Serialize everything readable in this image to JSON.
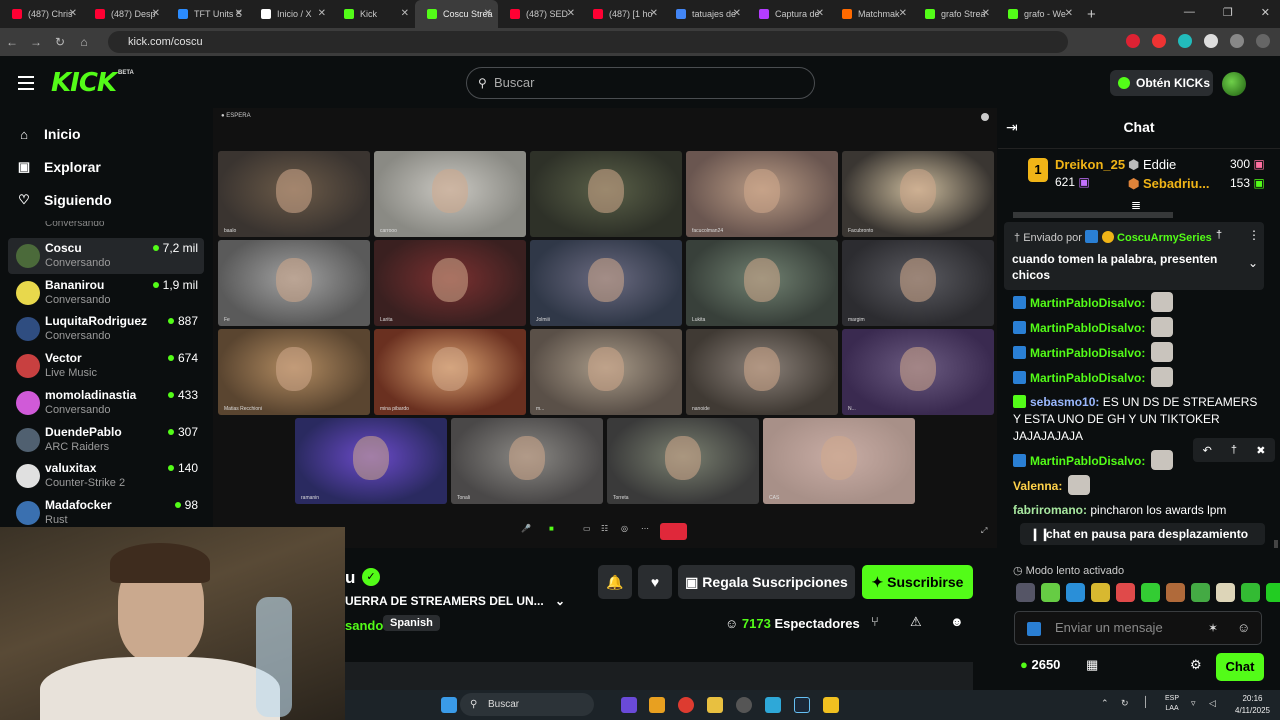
{
  "browser": {
    "tabs": [
      {
        "label": "(487) Chris",
        "color": "#ff0033"
      },
      {
        "label": "(487) Desp",
        "color": "#ff0033"
      },
      {
        "label": "TFT Units S",
        "color": "#2b8cff"
      },
      {
        "label": "Inicio / X",
        "color": "#ffffff"
      },
      {
        "label": "Kick",
        "color": "#53fc18"
      },
      {
        "label": "Coscu Strea",
        "color": "#53fc18"
      },
      {
        "label": "(487) SED",
        "color": "#ff0033"
      },
      {
        "label": "(487) [1 ho",
        "color": "#ff0033"
      },
      {
        "label": "tatuajes de",
        "color": "#4285f4"
      },
      {
        "label": "Captura de",
        "color": "#b43cff"
      },
      {
        "label": "Matchmak",
        "color": "#ff6a00"
      },
      {
        "label": "grafo Strea",
        "color": "#53fc18"
      },
      {
        "label": "grafo - We",
        "color": "#53fc18"
      }
    ],
    "url": "kick.com/coscu"
  },
  "header": {
    "logo": "KICK",
    "beta": "BETA",
    "search_placeholder": "Buscar",
    "kicks_button": "Obtén KICKs"
  },
  "sidebar": {
    "nav": [
      {
        "label": "Inicio",
        "icon": "home-icon"
      },
      {
        "label": "Explorar",
        "icon": "compass-icon"
      },
      {
        "label": "Siguiendo",
        "icon": "heart-icon"
      }
    ],
    "partial_top": "Conversando",
    "channels": [
      {
        "name": "Coscu",
        "sub": "Conversando",
        "viewers": "7,2 mil",
        "color": "#4b6a3a"
      },
      {
        "name": "Bananirou",
        "sub": "Conversando",
        "viewers": "1,9 mil",
        "color": "#e8d84c"
      },
      {
        "name": "LuquitaRodriguez",
        "sub": "Conversando",
        "viewers": "887",
        "color": "#2f4d80"
      },
      {
        "name": "Vector",
        "sub": "Live Music",
        "viewers": "674",
        "color": "#c84040"
      },
      {
        "name": "momoladinastia",
        "sub": "Conversando",
        "viewers": "433",
        "color": "#d05ad8"
      },
      {
        "name": "DuendePablo",
        "sub": "ARC Raiders",
        "viewers": "307",
        "color": "#506070"
      },
      {
        "name": "valuxitax",
        "sub": "Counter-Strike 2",
        "viewers": "140",
        "color": "#e0e0e0"
      },
      {
        "name": "Madafocker",
        "sub": "Rust",
        "viewers": "98",
        "color": "#3a70b0"
      }
    ]
  },
  "video": {
    "status": "ESPERA",
    "tiles": [
      {
        "name": "baalo",
        "c1": "#3a3430",
        "c2": "#6b5a48"
      },
      {
        "name": "carrooo",
        "c1": "#8a8a84",
        "c2": "#c8c6c0"
      },
      {
        "name": "",
        "c1": "#2e3128",
        "c2": "#5a6048"
      },
      {
        "name": "facucolman24",
        "c1": "#6a5650",
        "c2": "#b89a84"
      },
      {
        "name": "Facubronto",
        "c1": "#3a3632",
        "c2": "#c8b89a"
      },
      {
        "name": "Fe",
        "c1": "#5a5a5a",
        "c2": "#a0a0a0"
      },
      {
        "name": "Larita",
        "c1": "#3a2020",
        "c2": "#7a3030"
      },
      {
        "name": "Jolmiii",
        "c1": "#303848",
        "c2": "#6a6a80"
      },
      {
        "name": "Lukita",
        "c1": "#38403a",
        "c2": "#708070"
      },
      {
        "name": "margim",
        "c1": "#2c2c30",
        "c2": "#5a5a60"
      },
      {
        "name": "Matias Recchioni",
        "c1": "#5a4530",
        "c2": "#b08a60"
      },
      {
        "name": "mina pibardo",
        "c1": "#6a3020",
        "c2": "#d8a070"
      },
      {
        "name": "m...",
        "c1": "#5a5048",
        "c2": "#a89a88"
      },
      {
        "name": "nanoide",
        "c1": "#403a34",
        "c2": "#8a8078"
      },
      {
        "name": "N...",
        "c1": "#3a2a50",
        "c2": "#6a5a80"
      },
      {
        "name": "ramanin",
        "c1": "#2a2a60",
        "c2": "#6a4ac8"
      },
      {
        "name": "Tonali",
        "c1": "#4a4848",
        "c2": "#8a8884"
      },
      {
        "name": "Torreta",
        "c1": "#3a3a3a",
        "c2": "#7a8070"
      },
      {
        "name": "CAS",
        "c1": "#a89088",
        "c2": "#c8aca4"
      }
    ]
  },
  "stream": {
    "title_tail": "u",
    "stream_title": "UERRA DE STREAMERS DEL UN...",
    "category_tail": "sando",
    "language": "Spanish",
    "gift_button": "Regala Suscripciones",
    "subscribe_button": "Suscribirse",
    "viewers_count": "7173",
    "viewers_label": "Espectadores"
  },
  "chat": {
    "title": "Chat",
    "leaderboard": [
      {
        "rank": "1",
        "name": "Dreikon_25",
        "points": "621"
      },
      {
        "name": "Eddie",
        "points": "300"
      },
      {
        "name": "Sebadriu...",
        "points": "153"
      }
    ],
    "pinned": {
      "label": "Enviado por",
      "user": "CoscuArmySeries",
      "text": "cuando tomen la palabra, presenten chicos"
    },
    "messages": [
      {
        "user": "MartinPabloDisalvo:",
        "text": "",
        "color": "#53fc18",
        "emote": true
      },
      {
        "user": "MartinPabloDisalvo:",
        "text": "",
        "color": "#53fc18",
        "emote": true
      },
      {
        "user": "MartinPabloDisalvo:",
        "text": "",
        "color": "#53fc18",
        "emote": true
      },
      {
        "user": "MartinPabloDisalvo:",
        "text": "",
        "color": "#53fc18",
        "emote": true
      },
      {
        "user": "sebasmo10:",
        "text": "ES UN DS DE STREAMERS Y ESTA UNO DE GH Y UN TIKTOKER JAJAJAJAJA",
        "color": "#9ab8ff",
        "emote": false
      },
      {
        "user": "MartinPabloDisalvo:",
        "text": "",
        "color": "#53fc18",
        "emote": true
      },
      {
        "user": "Valenna:",
        "text": "",
        "color": "#ffd24a",
        "emote": true
      },
      {
        "user": "fabriromano:",
        "text": "pincharon los awards lpm",
        "color": "#a8e8a0",
        "emote": false
      }
    ],
    "pause_text": "chat en pausa para desplazamiento",
    "slow_mode": "Modo lento activado",
    "input_placeholder": "Enviar un mensaje",
    "points": "2650",
    "send_button": "Chat"
  },
  "taskbar": {
    "search_placeholder": "Buscar",
    "lang": "ESP",
    "lang2": "LAA",
    "time": "20:16",
    "date": "4/11/2025"
  }
}
